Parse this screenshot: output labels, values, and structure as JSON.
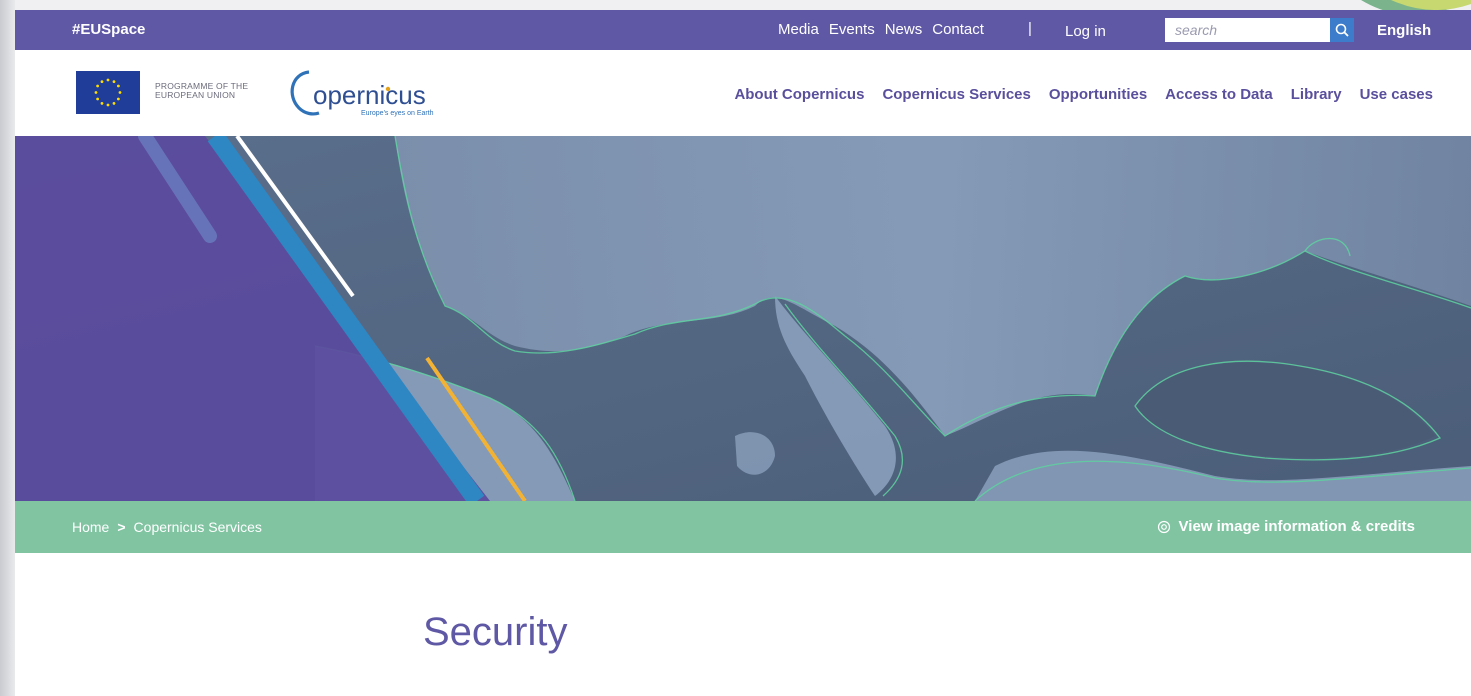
{
  "topbar": {
    "hashtag": "#EUSpace",
    "links": [
      "Media",
      "Events",
      "News",
      "Contact"
    ],
    "separator": "|",
    "login": "Log in",
    "search_placeholder": "search",
    "language": "English"
  },
  "header": {
    "programme_line1": "PROGRAMME OF THE",
    "programme_line2": "EUROPEAN UNION",
    "logo_text": "opernicus",
    "logo_letter": "C",
    "logo_tagline": "Europe's eyes on Earth",
    "nav": [
      "About Copernicus",
      "Copernicus Services",
      "Opportunities",
      "Access to Data",
      "Library",
      "Use cases"
    ]
  },
  "breadcrumb": {
    "home": "Home",
    "arrow": ">",
    "current": "Copernicus Services",
    "credits": "View image information & credits"
  },
  "page": {
    "title": "Security"
  },
  "colors": {
    "brand_purple": "#5f59a5",
    "nav_purple": "#5a4f9c",
    "breadcrumb_green": "#80c4a2",
    "search_blue": "#3d7ccb"
  }
}
